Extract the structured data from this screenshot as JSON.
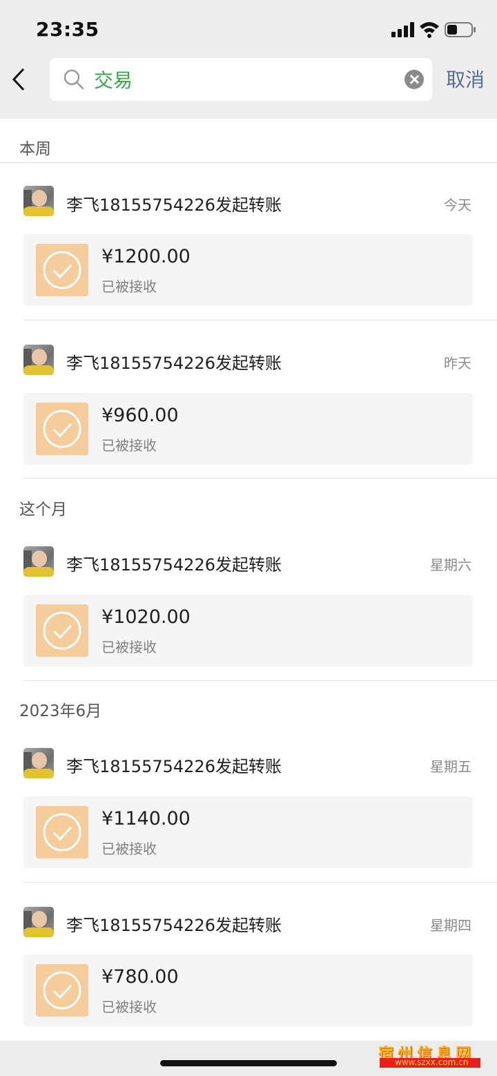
{
  "status_bar": {
    "time": "23:35"
  },
  "search": {
    "query": "交易",
    "cancel_label": "取消"
  },
  "sections": [
    {
      "label": "本周"
    },
    {
      "label": "这个月"
    },
    {
      "label": "2023年6月"
    }
  ],
  "transactions": [
    {
      "title": "李飞18155754226发起转账",
      "date": "今天",
      "amount": "¥1200.00",
      "status": "已被接收"
    },
    {
      "title": "李飞18155754226发起转账",
      "date": "昨天",
      "amount": "¥960.00",
      "status": "已被接收"
    },
    {
      "title": "李飞18155754226发起转账",
      "date": "星期六",
      "amount": "¥1020.00",
      "status": "已被接收"
    },
    {
      "title": "李飞18155754226发起转账",
      "date": "星期五",
      "amount": "¥1140.00",
      "status": "已被接收"
    },
    {
      "title": "李飞18155754226发起转账",
      "date": "星期四",
      "amount": "¥780.00",
      "status": "已被接收"
    }
  ],
  "watermark": {
    "line1": "宿州信息网",
    "line2": "www.szxx.com.cn"
  },
  "colors": {
    "accent_green": "#3aa34b",
    "link_blue": "#576b95",
    "transfer_icon_bg": "#f5cd9c"
  },
  "icons": {
    "back": "chevron-left-icon",
    "search": "search-icon",
    "clear": "clear-icon",
    "transfer": "check-circle-icon"
  }
}
